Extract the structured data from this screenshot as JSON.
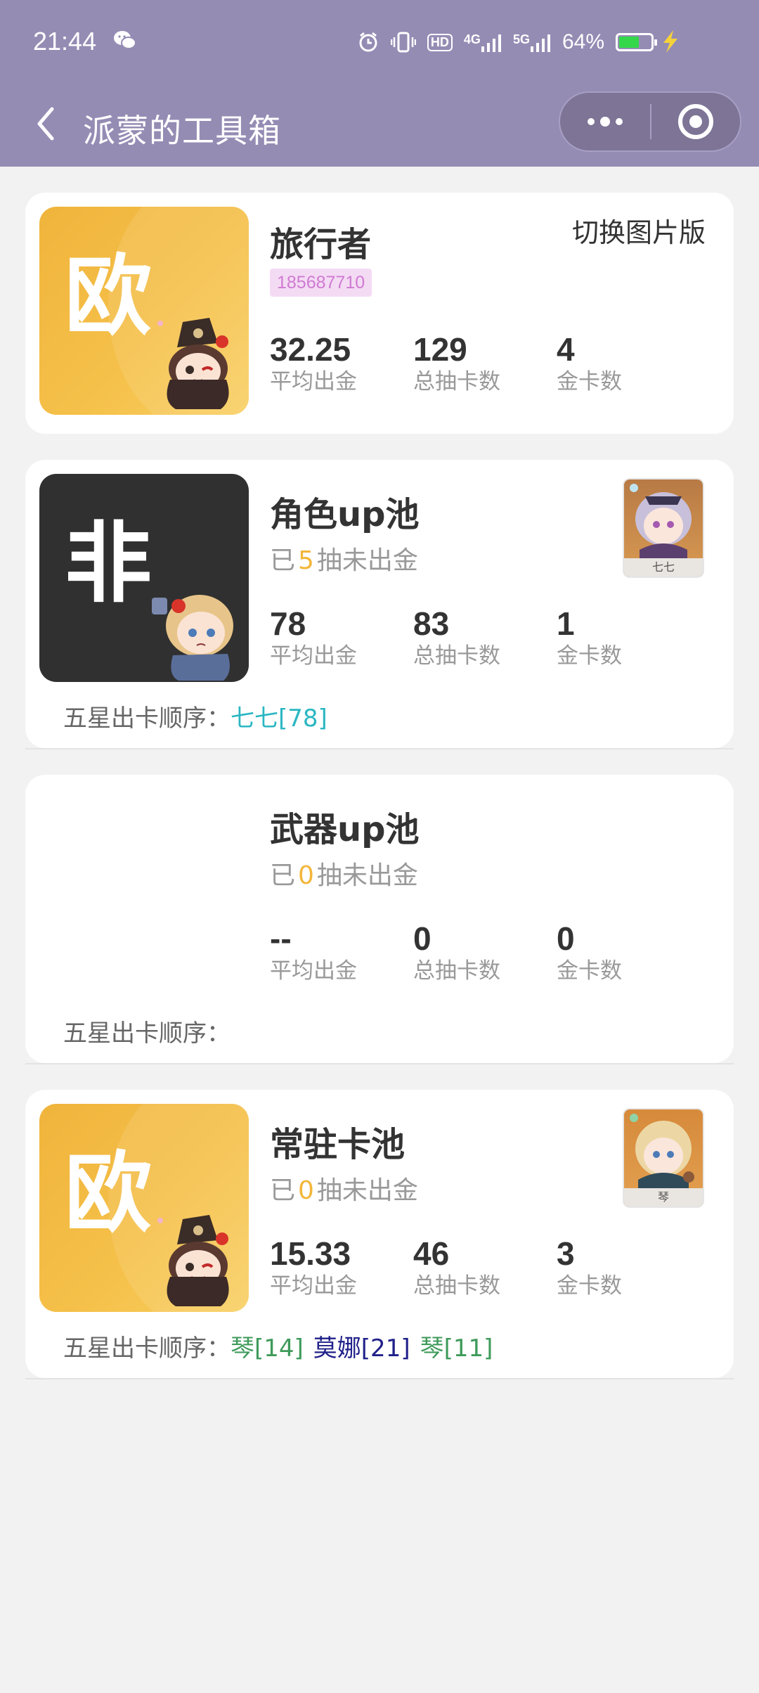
{
  "status_bar": {
    "time": "21:44",
    "network_hd": "HD",
    "network_4g": "4G",
    "network_5g": "5G",
    "battery_percent": "64%",
    "battery_level": 0.64
  },
  "nav": {
    "title": "派蒙的工具箱"
  },
  "profile": {
    "badge": "欧",
    "name": "旅行者",
    "uid": "185687710",
    "switch_label": "切换图片版",
    "stats": [
      {
        "value": "32.25",
        "label": "平均出金"
      },
      {
        "value": "129",
        "label": "总抽卡数"
      },
      {
        "value": "4",
        "label": "金卡数"
      }
    ]
  },
  "pools": [
    {
      "badge": "非",
      "title": "角色up池",
      "since_prefix": "已",
      "since_count": "5",
      "since_suffix": "抽未出金",
      "avatar_name": "七七",
      "stats": [
        {
          "value": "78",
          "label": "平均出金"
        },
        {
          "value": "83",
          "label": "总抽卡数"
        },
        {
          "value": "1",
          "label": "金卡数"
        }
      ],
      "order_label": "五星出卡顺序：",
      "order": [
        {
          "text": "七七[78]",
          "color": "#2bb7c2"
        }
      ]
    },
    {
      "title": "武器up池",
      "since_prefix": "已",
      "since_count": "0",
      "since_suffix": "抽未出金",
      "stats": [
        {
          "value": "--",
          "label": "平均出金"
        },
        {
          "value": "0",
          "label": "总抽卡数"
        },
        {
          "value": "0",
          "label": "金卡数"
        }
      ],
      "order_label": "五星出卡顺序："
    },
    {
      "badge": "欧",
      "title": "常驻卡池",
      "since_prefix": "已",
      "since_count": "0",
      "since_suffix": "抽未出金",
      "avatar_name": "琴",
      "stats": [
        {
          "value": "15.33",
          "label": "平均出金"
        },
        {
          "value": "46",
          "label": "总抽卡数"
        },
        {
          "value": "3",
          "label": "金卡数"
        }
      ],
      "order_label": "五星出卡顺序：",
      "order": [
        {
          "text": "琴[14]",
          "color": "#3e9a5a"
        },
        {
          "text": "莫娜[21]",
          "color": "#20208a"
        },
        {
          "text": "琴[11]",
          "color": "#3e9a5a"
        }
      ]
    }
  ],
  "colors": {
    "header": "#958cb4",
    "badge_gold": "#f5c14a",
    "badge_dark": "#303030",
    "highlight": "#f3b63a",
    "uid_bg": "#f4dbf4"
  }
}
